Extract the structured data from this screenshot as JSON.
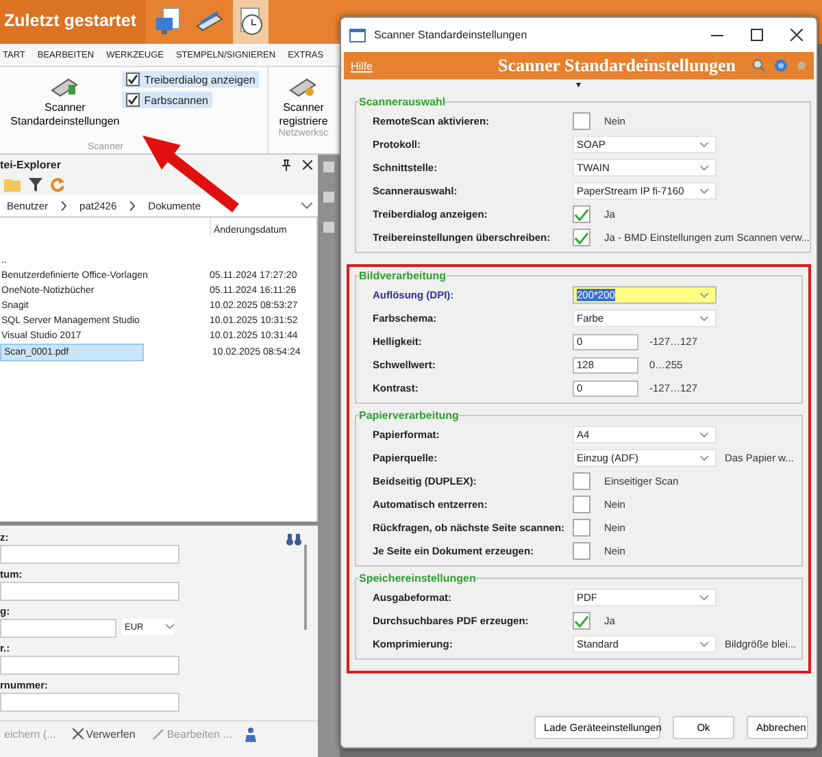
{
  "app": {
    "title": "Zuletzt gestartet",
    "menu": [
      "TART",
      "BEARBEITEN",
      "WERKZEUGE",
      "STEMPELN/SIGNIEREN",
      "EXTRAS"
    ],
    "ribbon": {
      "scan_button": [
        "Scanner",
        "Standardeinstellungen"
      ],
      "group_1": "Scanner",
      "options": [
        {
          "label": "Treiberdialog anzeigen",
          "checked": true
        },
        {
          "label": "Farbscannen",
          "checked": true
        }
      ],
      "register_button": [
        "Scanner",
        "registriere"
      ],
      "group_2": "Netzwerksc"
    }
  },
  "explorer": {
    "title": "tei-Explorer",
    "breadcrumb": [
      "Benutzer",
      "pat2426",
      "Dokumente"
    ],
    "date_column": "Änderungsdatum",
    "rows": [
      {
        "name": "..",
        "selected": false
      },
      {
        "name": "Benutzerdefinierte Office-Vorlagen",
        "date": "05.11.2024 17:27:20",
        "selected": false
      },
      {
        "name": "OneNote-Notizbücher",
        "date": "05.11.2024 16:11:26",
        "selected": false
      },
      {
        "name": "Snagit",
        "date": "10.02.2025 08:53:27",
        "selected": false
      },
      {
        "name": "SQL Server Management Studio",
        "date": "10.01.2025 10:31:52",
        "selected": false
      },
      {
        "name": "Visual Studio 2017",
        "date": "10.01.2025 10:31:44",
        "selected": false
      },
      {
        "name": "Scan_0001.pdf",
        "date": "10.02.2025 08:54:24",
        "selected": true
      }
    ]
  },
  "form": {
    "fields": [
      {
        "label": "z:"
      },
      {
        "label": "tum:"
      },
      {
        "label": "g:",
        "currency": "EUR"
      },
      {
        "label": "r.:"
      },
      {
        "label": "rnummer:"
      }
    ],
    "buttons": [
      {
        "kind": "save",
        "label": "eichern (...",
        "disabled": true
      },
      {
        "kind": "discard",
        "label": "Verwerfen",
        "disabled": false
      },
      {
        "kind": "edit",
        "label": "Bearbeiten ...",
        "disabled": true
      }
    ]
  },
  "dialog": {
    "title": "Scanner Standardeinstellungen",
    "help": "Hilfe",
    "header": "Scanner Standardeinstellungen",
    "caret": "▾",
    "sections": [
      {
        "highlighted": false,
        "groups": [
          {
            "title": "Scannerauswahl",
            "rows": [
              {
                "kind": "checkbox",
                "label": "RemoteScan aktivieren:",
                "checked": false,
                "text": "Nein",
                "focused": false
              },
              {
                "kind": "select",
                "label": "Protokoll:",
                "value": "SOAP",
                "focused": false
              },
              {
                "kind": "select",
                "label": "Schnittstelle:",
                "value": "TWAIN",
                "focused": false
              },
              {
                "kind": "select",
                "label": "Scannerauswahl:",
                "value": "PaperStream IP fi-7160",
                "focused": false
              },
              {
                "kind": "checkbox",
                "label": "Treiberdialog anzeigen:",
                "checked": true,
                "text": "Ja",
                "focused": false
              },
              {
                "kind": "checkbox",
                "label": "Treibereinstellungen überschreiben:",
                "checked": true,
                "text": "Ja - BMD Einstellungen zum Scannen verw...",
                "focused": false
              }
            ]
          }
        ]
      },
      {
        "highlighted": true,
        "groups": [
          {
            "title": "Bildverarbeitung",
            "rows": [
              {
                "kind": "select",
                "label": "Auflösung (DPI):",
                "value": "200*200",
                "focused": true
              },
              {
                "kind": "select",
                "label": "Farbschema:",
                "value": "Farbe",
                "focused": false
              },
              {
                "kind": "input",
                "label": "Helligkeit:",
                "value": "0",
                "range": "-127…127",
                "focused": false
              },
              {
                "kind": "input",
                "label": "Schwellwert:",
                "value": "128",
                "range": "0…255",
                "focused": false
              },
              {
                "kind": "input",
                "label": "Kontrast:",
                "value": "0",
                "range": "-127…127",
                "focused": false
              }
            ]
          },
          {
            "title": "Papierverarbeitung",
            "rows": [
              {
                "kind": "select",
                "label": "Papierformat:",
                "value": "A4",
                "focused": false
              },
              {
                "kind": "select",
                "label": "Papierquelle:",
                "value": "Einzug (ADF)",
                "note": "Das Papier w...",
                "focused": false
              },
              {
                "kind": "checkbox",
                "label": "Beidseitig (DUPLEX):",
                "checked": false,
                "text": "Einseitiger Scan",
                "focused": false
              },
              {
                "kind": "checkbox",
                "label": "Automatisch entzerren:",
                "checked": false,
                "text": "Nein",
                "focused": false
              },
              {
                "kind": "checkbox",
                "label": "Rückfragen, ob nächste Seite scannen:",
                "checked": false,
                "text": "Nein",
                "focused": false
              },
              {
                "kind": "checkbox",
                "label": "Je Seite ein Dokument erzeugen:",
                "checked": false,
                "text": "Nein",
                "focused": false
              }
            ]
          },
          {
            "title": "Speichereinstellungen",
            "rows": [
              {
                "kind": "select",
                "label": "Ausgabeformat:",
                "value": "PDF",
                "focused": false
              },
              {
                "kind": "checkbox",
                "label": "Durchsuchbares PDF erzeugen:",
                "checked": true,
                "text": "Ja",
                "focused": false
              },
              {
                "kind": "select",
                "label": "Komprimierung:",
                "value": "Standard",
                "note": "Bildgröße blei...",
                "focused": false
              }
            ]
          }
        ]
      }
    ],
    "buttons": [
      "Lade Geräteeinstellungen",
      "Ok",
      "Abbrechen"
    ]
  }
}
